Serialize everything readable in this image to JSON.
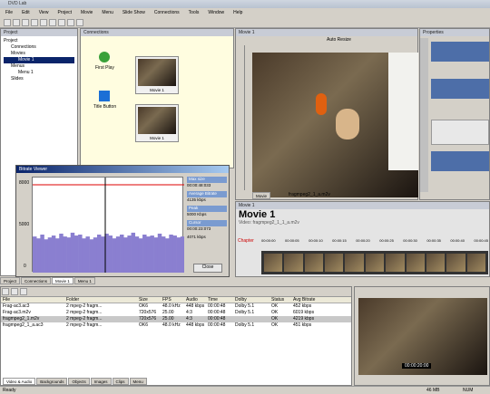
{
  "window": {
    "title": "DVD Lab"
  },
  "menu": [
    "File",
    "Edit",
    "View",
    "Project",
    "Movie",
    "Menu",
    "Slide Show",
    "Connections",
    "Tools",
    "Window",
    "Help"
  ],
  "project_panel": {
    "title": "Project",
    "items": [
      "Project",
      "Connections",
      "Movies",
      "Movie 1",
      "Menus",
      "Menu 1",
      "Slides"
    ]
  },
  "connections_panel": {
    "title": "Connections",
    "first_play": "First Play",
    "title_button": "Title Button",
    "movie_label": "Movie 1",
    "movie_label2": "Movie 1"
  },
  "bitrate": {
    "title": "Bitrate Viewer",
    "y_labels": [
      "8000",
      "5000",
      "0"
    ],
    "max_label": "Max size",
    "max_value": "00:00:48:033",
    "avg_label": "Average Bitrate",
    "avg_value": "4135 kbps",
    "peak_label": "Peak",
    "peak_value": "5000 Kbps",
    "cursor_label": "Cursor",
    "cursor_value": "00:00:23:073",
    "cursor_rate": "4071 kbps",
    "close": "Close",
    "bars": [
      0.38,
      0.36,
      0.4,
      0.35,
      0.37,
      0.39,
      0.36,
      0.41,
      0.38,
      0.37,
      0.42,
      0.39,
      0.4,
      0.36,
      0.38,
      0.35,
      0.37,
      0.4,
      0.38,
      0.41,
      0.39,
      0.36,
      0.38,
      0.4,
      0.37,
      0.39,
      0.42,
      0.38,
      0.36,
      0.4,
      0.38,
      0.39,
      0.37,
      0.41,
      0.38,
      0.36,
      0.4,
      0.39,
      0.37,
      0.38
    ]
  },
  "movie_view": {
    "title": "Movie 1",
    "zoom": "Auto Resize",
    "tab": "Movie",
    "file": "fragmpeg2_1_a.m2v"
  },
  "properties": {
    "title": "Properties",
    "tabs": [
      "Color",
      "Line",
      "Transp",
      "Mask"
    ]
  },
  "movie_timeline": {
    "title": "Movie 1",
    "header": "Movie 1",
    "subtitle": "Video: fragmpeg2_1_1_a.m2v",
    "chapter": "Chapter",
    "times": [
      "00:00:00",
      "00:00:05",
      "00:00:10",
      "00:00:15",
      "00:00:20",
      "00:00:25",
      "00:00:30",
      "00:00:35",
      "00:00:40",
      "00:00:45"
    ]
  },
  "bottom_tabs": [
    "Project",
    "Connections",
    "Movie 1",
    "Menu 1"
  ],
  "assets": {
    "columns": [
      "File",
      "Folder",
      "Size",
      "FPS",
      "Audio",
      "Time",
      "Dolby",
      "Status",
      "Avg Bitrate"
    ],
    "rows": [
      [
        "Frag-ac3.ac3",
        "2 mpeg-2 fragm...",
        "OK6",
        "48.0 kHz",
        "448 kbps",
        "00:00:48",
        "Dolby 5.1",
        "OK",
        "452 kbps"
      ],
      [
        "Frag-ac3.m2v",
        "2 mpeg-2 fragm...",
        "720x576",
        "25.00",
        "4:3",
        "00:00:48",
        "Dolby 5.1",
        "OK",
        "6019 kbps"
      ],
      [
        "fragmpeg2_1.m2v",
        "2 mpeg-2 fragm...",
        "720x576",
        "25.00",
        "4:3",
        "00:00:48",
        "",
        "OK",
        "4219 kbps"
      ],
      [
        "fragmpeg2_1_a.ac3",
        "2 mpeg-2 fragm...",
        "OK6",
        "48.0 kHz",
        "448 kbps",
        "00:00:48",
        "Dolby 5.1",
        "OK",
        "451 kbps"
      ]
    ]
  },
  "asset_tabs": [
    "Video & Audio",
    "Backgrounds",
    "Objects",
    "Images",
    "Clips",
    "Menu"
  ],
  "preview": {
    "timecode": "00:00:20:00"
  },
  "status": {
    "left": "Ready",
    "right": "46 MB",
    "right2": "NUM"
  }
}
